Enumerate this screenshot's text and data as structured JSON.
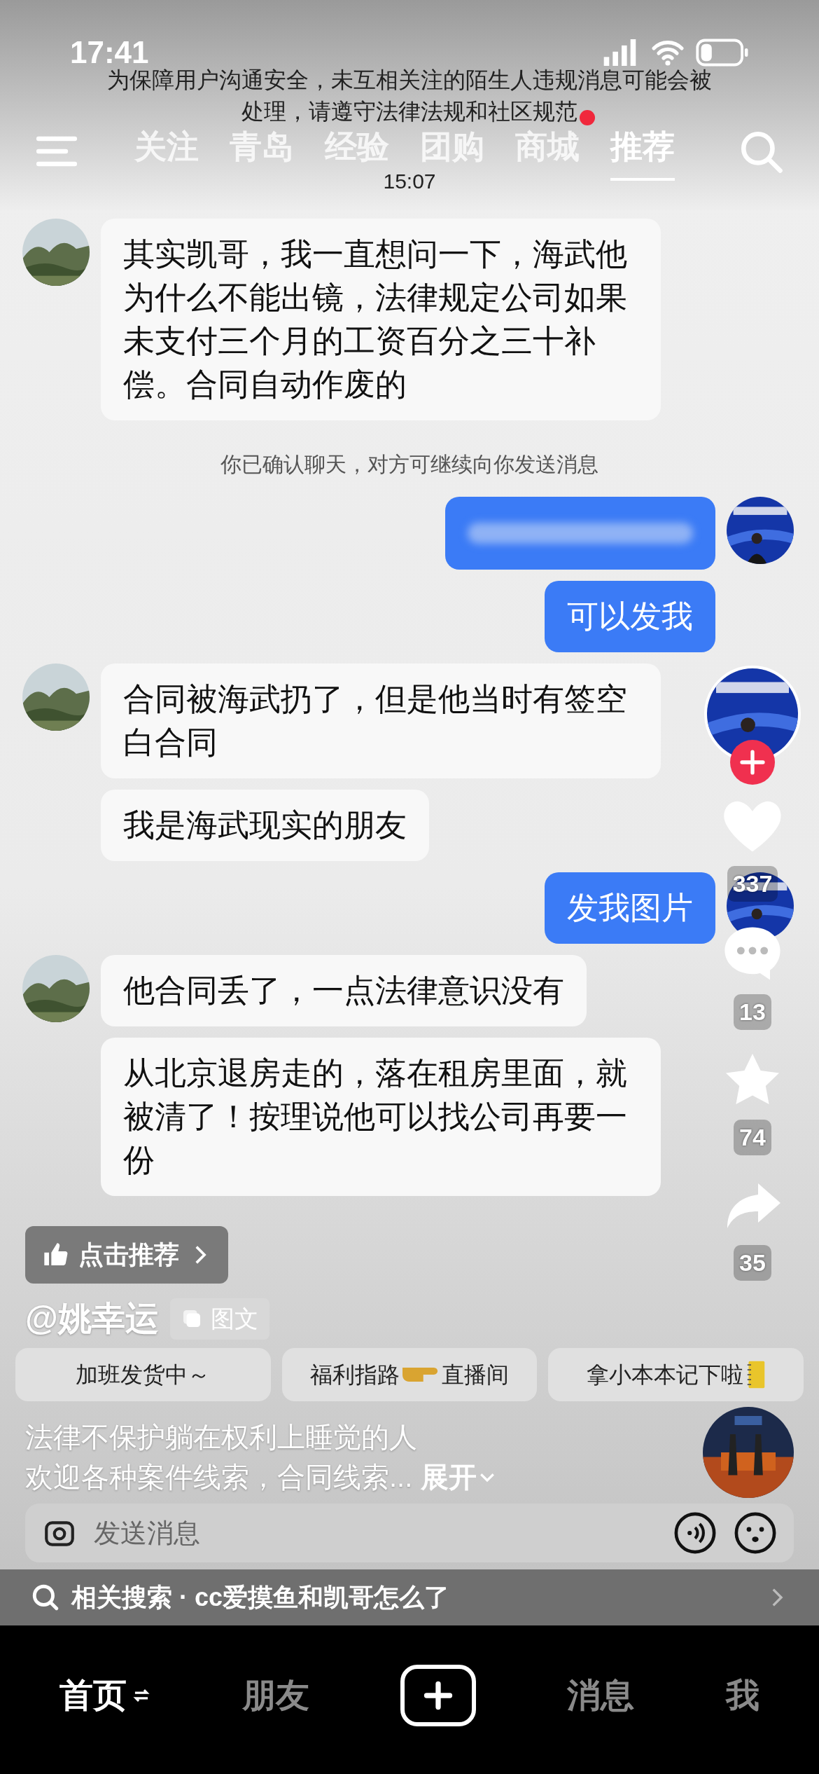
{
  "status_bar": {
    "time": "17:41"
  },
  "notice": "为保障用户沟通安全，未互相关注的陌生人违规消息可能会被处理，请遵守法律法规和社区规范",
  "tabs": [
    {
      "label": "关注",
      "selected": false,
      "badge": false
    },
    {
      "label": "青岛",
      "selected": false,
      "badge": false
    },
    {
      "label": "经验",
      "selected": false,
      "badge": false
    },
    {
      "label": "团购",
      "selected": false,
      "badge": false
    },
    {
      "label": "商城",
      "selected": false,
      "badge": true
    },
    {
      "label": "推荐",
      "selected": true,
      "badge": false
    }
  ],
  "chat_time": "15:07",
  "messages": [
    {
      "kind": "left_text",
      "avatar": true,
      "text": "其实凯哥，我一直想问一下，海武他为什么不能出镜，法律规定公司如果未支付三个月的工资百分之三十补偿。合同自动作废的"
    },
    {
      "kind": "system",
      "text": "你已确认聊天，对方可继续向你发送消息"
    },
    {
      "kind": "right_blurred",
      "avatar": true
    },
    {
      "kind": "right_text",
      "avatar": false,
      "text": "可以发我"
    },
    {
      "kind": "left_text",
      "avatar": true,
      "text": "合同被海武扔了，但是他当时有签空白合同"
    },
    {
      "kind": "left_text",
      "avatar": false,
      "text": "我是海武现实的朋友"
    },
    {
      "kind": "right_text",
      "avatar": true,
      "text": "发我图片"
    },
    {
      "kind": "left_text",
      "avatar": true,
      "text": "他合同丢了，一点法律意识没有"
    },
    {
      "kind": "left_text",
      "avatar": false,
      "text": "从北京退房走的，落在租房里面，就被清了！按理说他可以找公司再要一份"
    }
  ],
  "rail": [
    {
      "kind": "follow"
    },
    {
      "kind": "like",
      "count": "337"
    },
    {
      "kind": "comment",
      "count": "13"
    },
    {
      "kind": "favorite",
      "count": "74"
    },
    {
      "kind": "share",
      "count": "35"
    }
  ],
  "recommend_button": "点击推荐",
  "author": "@姚幸运",
  "post_type": "图文",
  "chips": [
    {
      "kind": "plain",
      "parts": [
        "加班发货中～"
      ]
    },
    {
      "kind": "icon_middle",
      "parts": [
        "福利指路",
        "直播间"
      ]
    },
    {
      "kind": "icon_end",
      "parts": [
        "拿小本本记下啦"
      ]
    }
  ],
  "description": [
    "法律不保护躺在权利上睡觉的人",
    "欢迎各种案件线索，合同线索..."
  ],
  "expand": "展开",
  "message_field": {
    "placeholder": "发送消息"
  },
  "related_search": "相关搜索 · cc爱摸鱼和凯哥怎么了",
  "nav": [
    {
      "kind": "text",
      "label": "首页",
      "selected": true
    },
    {
      "kind": "text",
      "label": "朋友",
      "selected": false
    },
    {
      "kind": "create"
    },
    {
      "kind": "text",
      "label": "消息",
      "selected": false
    },
    {
      "kind": "text",
      "label": "我",
      "selected": false
    }
  ]
}
